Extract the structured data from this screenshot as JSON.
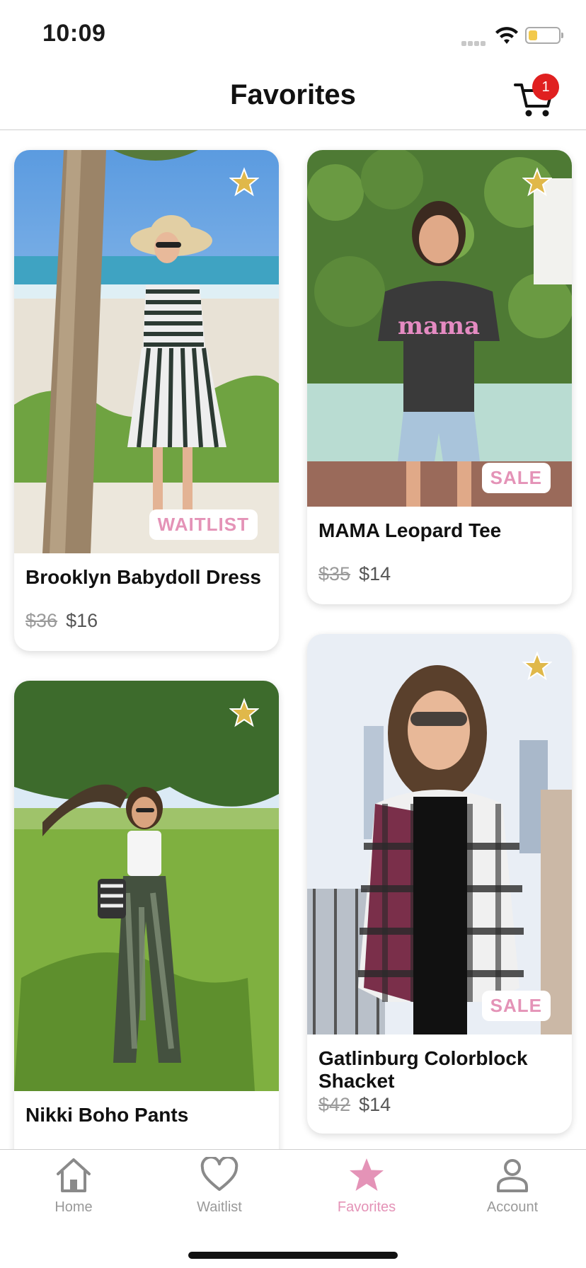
{
  "status_bar": {
    "time": "10:09"
  },
  "header": {
    "title": "Favorites",
    "cart_count": "1"
  },
  "products": [
    {
      "name": "Brooklyn Babydoll Dress",
      "old_price": "$36",
      "price": "$16",
      "tag": "WAITLIST",
      "favorited": true
    },
    {
      "name": "MAMA Leopard Tee",
      "old_price": "$35",
      "price": "$14",
      "tag": "SALE",
      "favorited": true
    },
    {
      "name": "Nikki Boho Pants",
      "favorited": true
    },
    {
      "name": "Gatlinburg Colorblock Shacket",
      "old_price": "$42",
      "price": "$14",
      "tag": "SALE",
      "favorited": true
    }
  ],
  "tab_bar": {
    "home": "Home",
    "waitlist": "Waitlist",
    "favorites": "Favorites",
    "account": "Account",
    "active": "favorites"
  },
  "colors": {
    "accent_pink": "#e493b7",
    "star_gold": "#e0b84a",
    "badge_red": "#e02020"
  },
  "icons": [
    "wifi-icon",
    "battery-icon",
    "cart-icon",
    "star-icon",
    "home-icon",
    "heart-icon",
    "account-icon"
  ]
}
